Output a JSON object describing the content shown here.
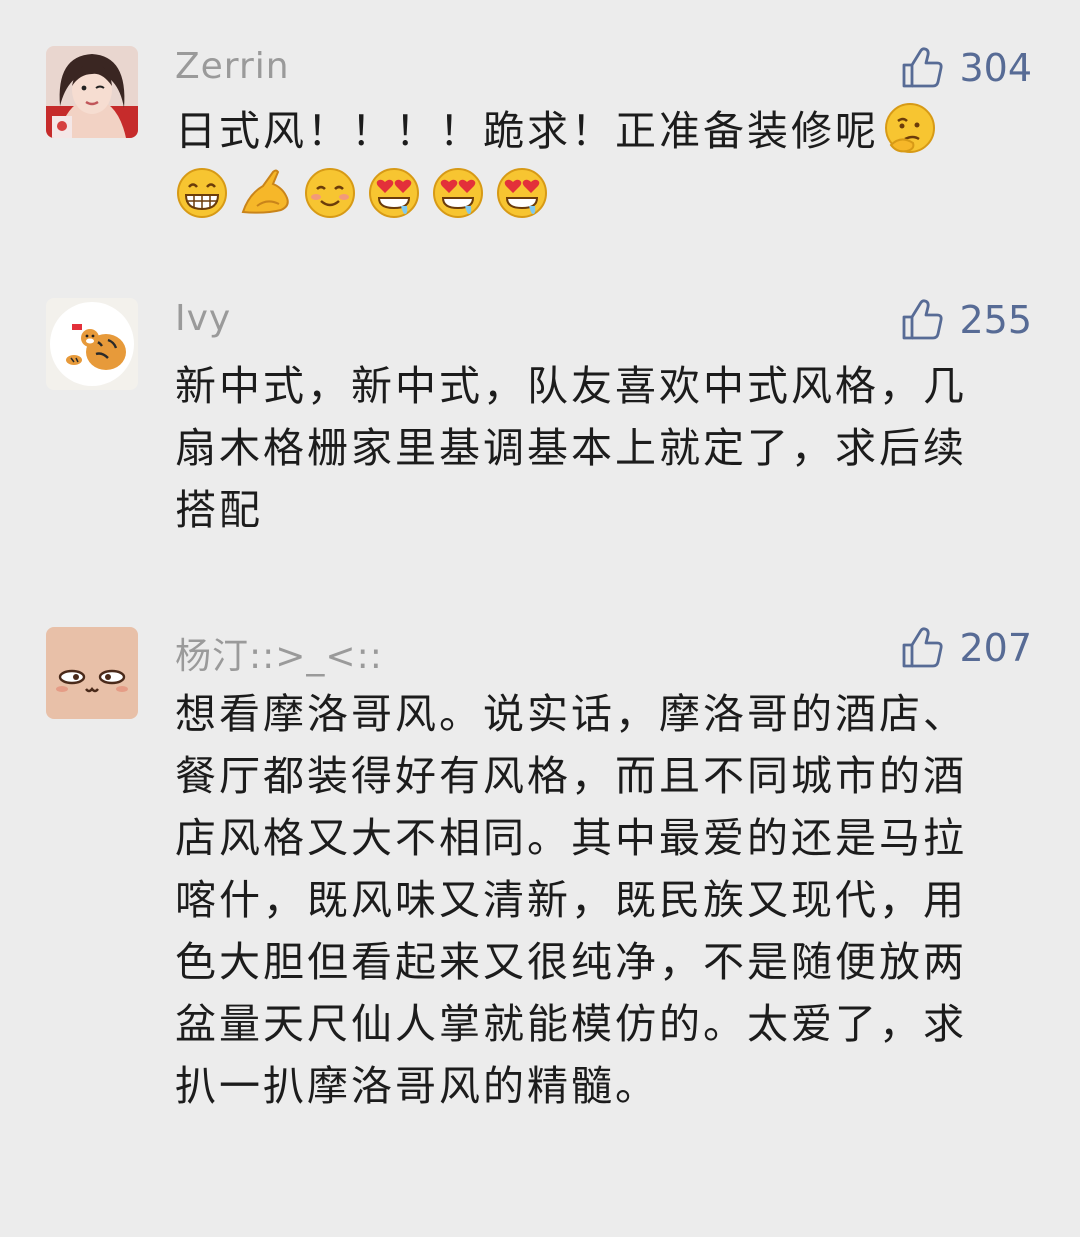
{
  "comments": [
    {
      "avatar_icon": "woman-photo-avatar",
      "nickname": "Zerrin",
      "likes": "304",
      "text": "日式风！！！！跪求！正准备装修呢",
      "emojis": [
        "thinking-face-emoji",
        "grinning-face-emoji",
        "ok-hand-emoji",
        "smiling-face-emoji",
        "heart-eyes-drool-emoji",
        "heart-eyes-drool-emoji",
        "heart-eyes-drool-emoji"
      ]
    },
    {
      "avatar_icon": "tiger-illustration-avatar",
      "nickname": "Ivy",
      "likes": "255",
      "text": "新中式，新中式，队友喜欢中式风格，几扇木格栅家里基调基本上就定了，求后续搭配"
    },
    {
      "avatar_icon": "cartoon-face-avatar",
      "nickname": "杨汀::>_<::",
      "likes": "207",
      "text": "想看摩洛哥风。说实话，摩洛哥的酒店、餐厅都装得好有风格，而且不同城市的酒店风格又大不相同。其中最爱的还是马拉喀什，既风味又清新，既民族又现代，用色大胆但看起来又很纯净，不是随便放两盆量天尺仙人掌就能模仿的。太爱了，求扒一扒摩洛哥风的精髓。"
    }
  ],
  "colors": {
    "background": "#ececec",
    "nickname": "#9a9a9a",
    "like": "#576b95",
    "text": "#1c1c1c"
  }
}
